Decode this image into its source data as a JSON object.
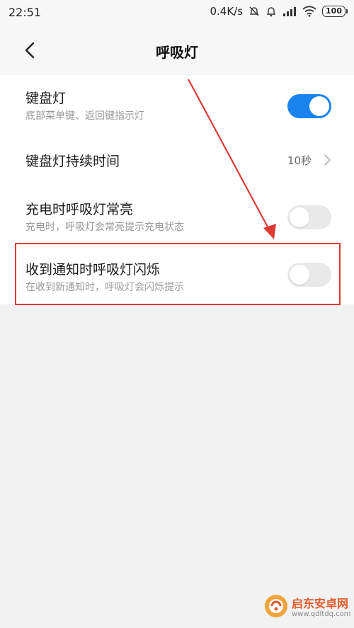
{
  "status_bar": {
    "time": "22:51",
    "network_speed": "0.4K/s",
    "battery": "100",
    "icons": [
      "alarm-muted-icon",
      "alarm-icon",
      "signal-icon",
      "wifi-icon",
      "battery-icon"
    ]
  },
  "header": {
    "back_icon": "chevron-left-icon",
    "title": "呼吸灯"
  },
  "settings": {
    "keyboard_light": {
      "title": "键盘灯",
      "subtitle": "底部菜单键、返回键指示灯",
      "enabled": true
    },
    "keyboard_duration": {
      "title": "键盘灯持续时间",
      "value": "10秒",
      "icon": "chevron-right-icon"
    },
    "charging_light": {
      "title": "充电时呼吸灯常亮",
      "subtitle": "充电时，呼吸灯会常亮提示充电状态",
      "enabled": false
    },
    "notification_blink": {
      "title": "收到通知时呼吸灯闪烁",
      "subtitle": "在收到新通知时，呼吸灯会闪烁提示",
      "enabled": false
    }
  },
  "watermark": {
    "name": "启东安卓网",
    "url": "www.qdltdq.com"
  },
  "colors": {
    "toggle_on": "#1a83f0",
    "toggle_off": "#e9e9e9",
    "annotation": "#dd3a36",
    "watermark_text": "#e25a2a"
  }
}
